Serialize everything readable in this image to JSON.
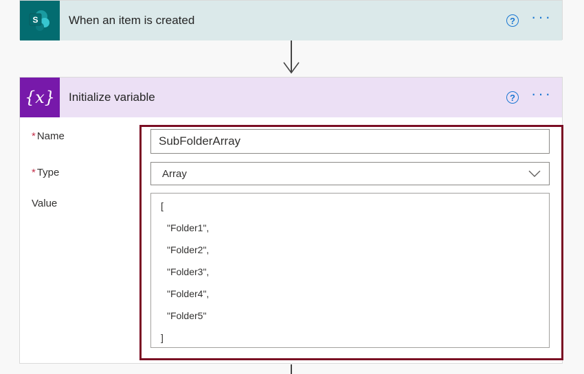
{
  "trigger": {
    "title": "When an item is created",
    "icon": "sharepoint-icon",
    "icon_letter": "S",
    "help": "?",
    "more": "···"
  },
  "action": {
    "title": "Initialize variable",
    "icon": "variable-icon",
    "icon_text": "{x}",
    "help": "?",
    "more": "···",
    "required_mark": "*",
    "fields": {
      "name_label": "Name",
      "name_value": "SubFolderArray",
      "type_label": "Type",
      "type_value": "Array",
      "value_label": "Value",
      "value_lines": [
        "[",
        "\"Folder1\",",
        "\"Folder2\",",
        "\"Folder3\",",
        "\"Folder4\",",
        "\"Folder5\"",
        "]"
      ]
    }
  },
  "colors": {
    "trigger_header": "#dbe9ea",
    "action_header": "#ece0f5",
    "sharepoint": "#036c70",
    "variable": "#7719aa",
    "highlight": "#7a0d23",
    "link": "#1976d2"
  }
}
